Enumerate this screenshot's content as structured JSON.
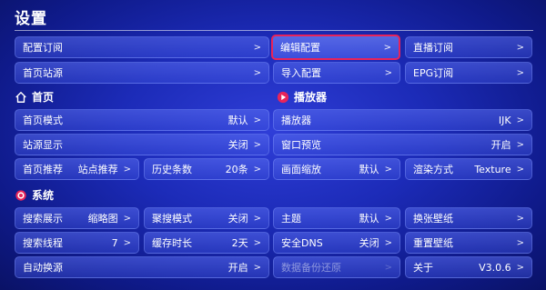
{
  "title": "设置",
  "top": {
    "config_sub": "配置订阅",
    "edit_config": "编辑配置",
    "live_sub": "直播订阅",
    "home_site": "首页站源",
    "import_config": "导入配置",
    "epg_sub": "EPG订阅"
  },
  "home": {
    "section": "首页",
    "mode": {
      "label": "首页模式",
      "value": "默认"
    },
    "site_display": {
      "label": "站源显示",
      "value": "关闭"
    },
    "recommend": {
      "label": "首页推荐",
      "value": "站点推荐"
    },
    "history": {
      "label": "历史条数",
      "value": "20条"
    }
  },
  "player": {
    "section": "播放器",
    "player": {
      "label": "播放器",
      "value": "IJK"
    },
    "preview": {
      "label": "窗口预览",
      "value": "开启"
    },
    "scale": {
      "label": "画面缩放",
      "value": "默认"
    },
    "render": {
      "label": "渲染方式",
      "value": "Texture"
    }
  },
  "system": {
    "section": "系统",
    "search_display": {
      "label": "搜索展示",
      "value": "缩略图"
    },
    "agg_mode": {
      "label": "聚搜模式",
      "value": "关闭"
    },
    "theme": {
      "label": "主题",
      "value": "默认"
    },
    "change_wallpaper": {
      "label": "换张壁纸"
    },
    "search_threads": {
      "label": "搜索线程",
      "value": "7"
    },
    "cache_time": {
      "label": "缓存时长",
      "value": "2天"
    },
    "safe_dns": {
      "label": "安全DNS",
      "value": "关闭"
    },
    "reset_wallpaper": {
      "label": "重置壁纸"
    },
    "auto_switch": {
      "label": "自动换源",
      "value": "开启"
    },
    "backup_restore": {
      "label": "数据备份还原"
    },
    "about": {
      "label": "关于",
      "value": "V3.0.6"
    }
  },
  "chevron": ">",
  "colors": {
    "highlight": "#e8245a",
    "bg": "#1c2bb8"
  }
}
